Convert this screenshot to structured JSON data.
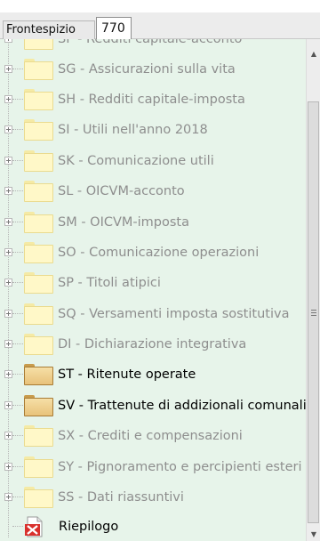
{
  "tabs": [
    {
      "label": "Frontespizio"
    },
    {
      "label": "770"
    }
  ],
  "tree": {
    "items": [
      {
        "label": "SF - Redditi capitale-acconto",
        "state": "faded"
      },
      {
        "label": "SG - Assicurazioni sulla vita",
        "state": "faded"
      },
      {
        "label": "SH - Redditi capitale-imposta",
        "state": "faded"
      },
      {
        "label": "SI - Utili nell'anno 2018",
        "state": "faded"
      },
      {
        "label": "SK - Comunicazione utili",
        "state": "faded"
      },
      {
        "label": "SL - OICVM-acconto",
        "state": "faded"
      },
      {
        "label": "SM - OICVM-imposta",
        "state": "faded"
      },
      {
        "label": "SO - Comunicazione operazioni",
        "state": "faded"
      },
      {
        "label": "SP - Titoli atipici",
        "state": "faded"
      },
      {
        "label": "SQ - Versamenti imposta sostitutiva",
        "state": "faded"
      },
      {
        "label": "DI - Dichiarazione integrativa",
        "state": "faded"
      },
      {
        "label": "ST - Ritenute operate",
        "state": "active"
      },
      {
        "label": "SV - Trattenute di addizionali comunali",
        "state": "active"
      },
      {
        "label": "SX - Crediti e compensazioni",
        "state": "faded"
      },
      {
        "label": "SY - Pignoramento e percipienti esteri",
        "state": "faded"
      },
      {
        "label": "SS - Dati riassuntivi",
        "state": "faded"
      }
    ],
    "summary": {
      "label": "Riepilogo",
      "icon": "summary-x-icon"
    }
  },
  "colors": {
    "tree_background": "#e7f4ea",
    "faded_text": "#8e8e8e",
    "active_text": "#000000"
  }
}
